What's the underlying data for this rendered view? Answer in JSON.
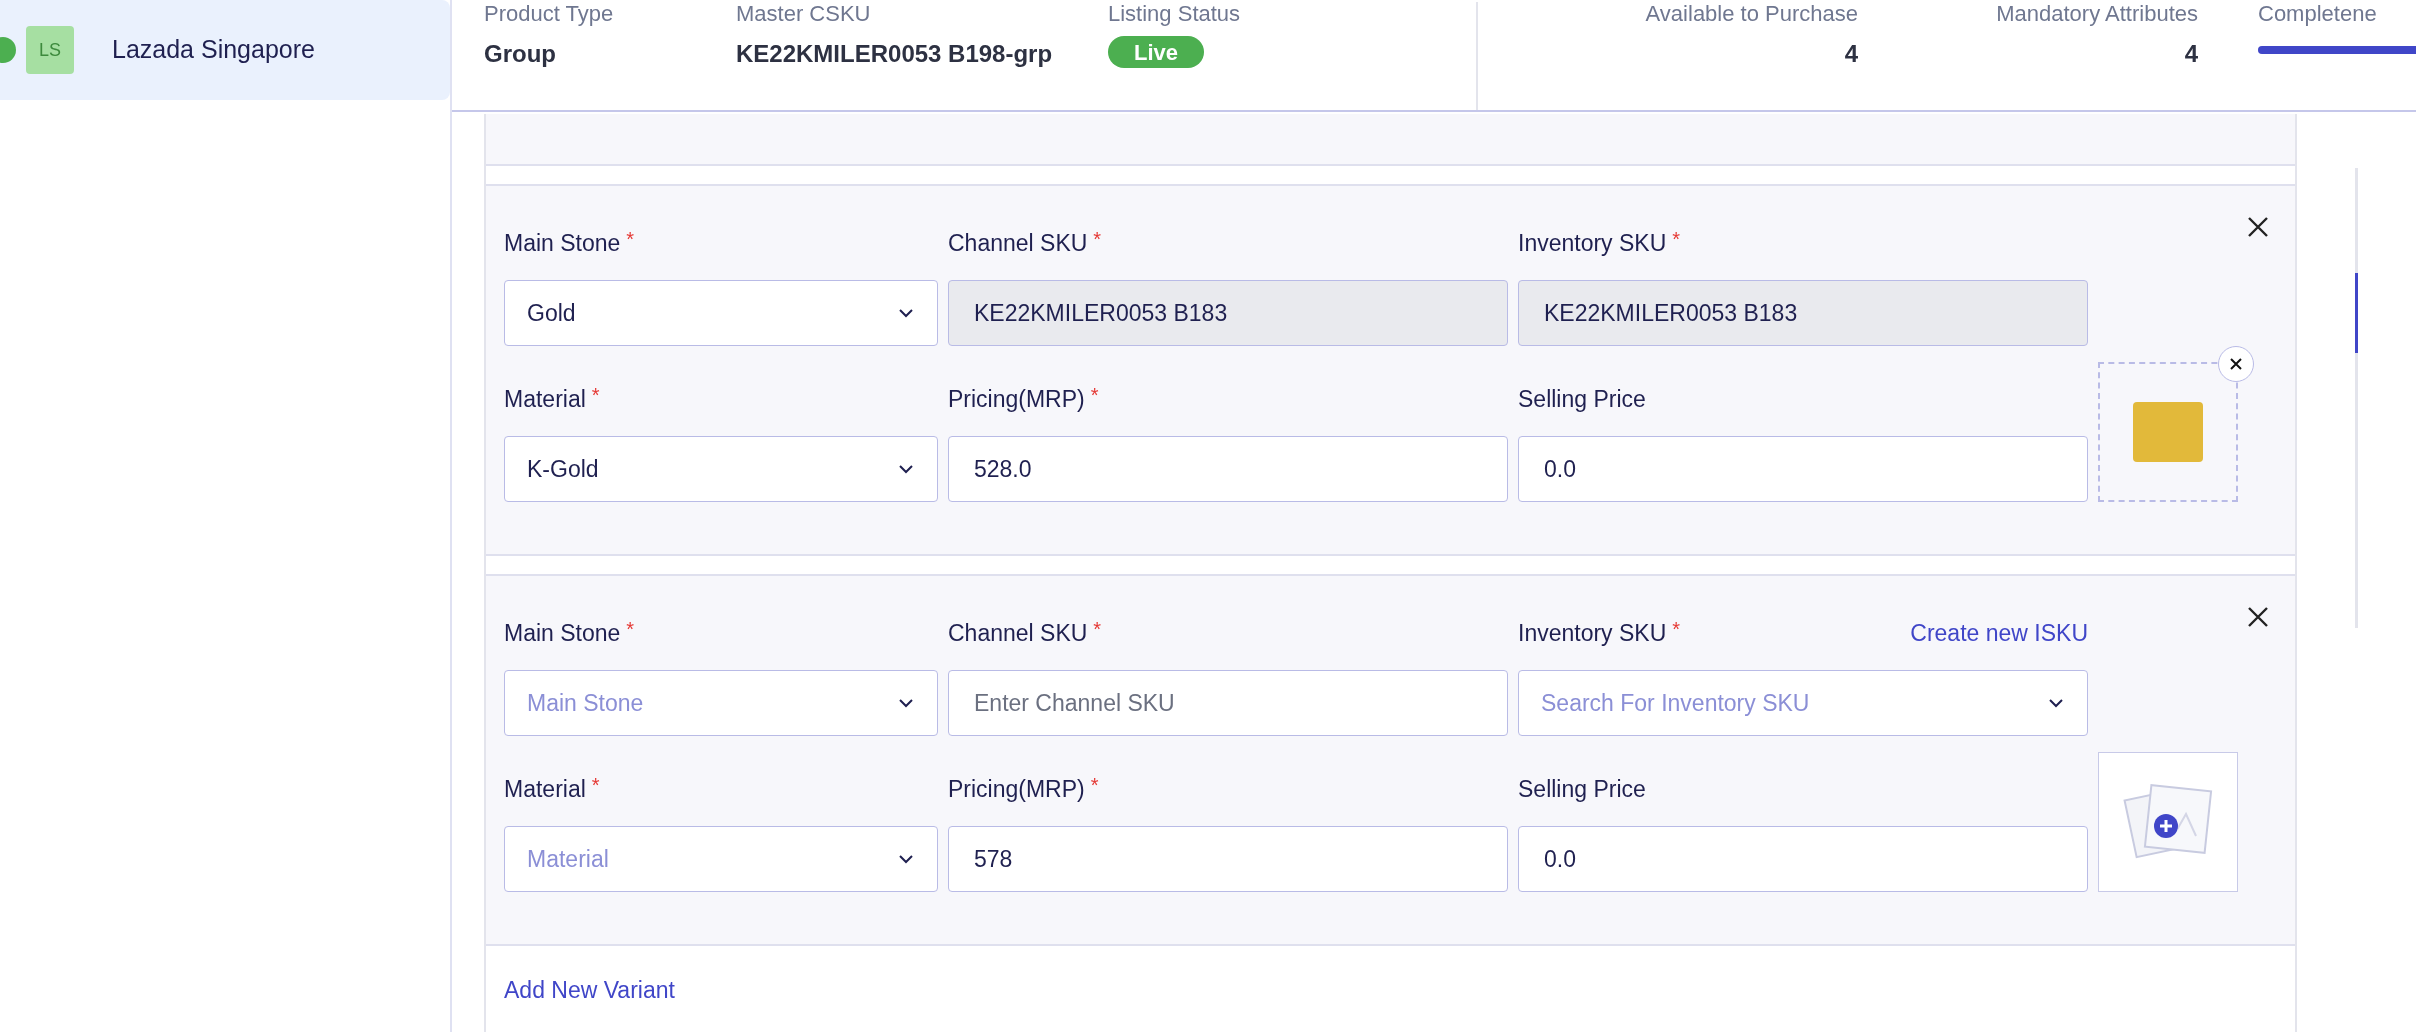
{
  "sidebar": {
    "items": [
      {
        "initials": "LS",
        "name": "Lazada Singapore",
        "selected": true,
        "online": true
      }
    ]
  },
  "header": {
    "fields": [
      {
        "label": "Product Type",
        "value": "Group"
      },
      {
        "label": "Master CSKU",
        "value": "KE22KMILER0053 B198-grp"
      },
      {
        "label": "Listing Status",
        "badge": "Live"
      }
    ],
    "stats": [
      {
        "label": "Available to Purchase",
        "value": "4"
      },
      {
        "label": "Mandatory Attributes",
        "value": "4"
      }
    ],
    "completeness": {
      "label": "Completene",
      "level": 1
    }
  },
  "variants": [
    {
      "fields": [
        {
          "kind": "select",
          "label": "Main Stone",
          "required_mark": "*",
          "value": "Gold"
        },
        {
          "kind": "input",
          "label": "Channel SKU",
          "required_mark": "*",
          "value": "KE22KMILER0053 B183",
          "disabled": true
        },
        {
          "kind": "input",
          "label": "Inventory SKU",
          "required_mark": "*",
          "value": "KE22KMILER0053 B183",
          "disabled": true
        },
        {
          "kind": "select",
          "label": "Material",
          "required_mark": "*",
          "value": "K-Gold"
        },
        {
          "kind": "input",
          "label": "Pricing(MRP)",
          "required_mark": "*",
          "value": "528.0"
        },
        {
          "kind": "input",
          "label": "Selling Price",
          "value": "0.0"
        }
      ],
      "image": {
        "kind": "photo"
      }
    },
    {
      "link": "Create new ISKU",
      "fields": [
        {
          "kind": "select",
          "label": "Main Stone",
          "required_mark": "*",
          "placeholder": "Main Stone"
        },
        {
          "kind": "input",
          "label": "Channel SKU",
          "required_mark": "*",
          "placeholder": "Enter Channel SKU"
        },
        {
          "kind": "select",
          "label": "Inventory SKU",
          "required_mark": "*",
          "placeholder": "Search For Inventory SKU"
        },
        {
          "kind": "select",
          "label": "Material",
          "required_mark": "*",
          "placeholder": "Material"
        },
        {
          "kind": "input",
          "label": "Pricing(MRP)",
          "required_mark": "*",
          "value": "578"
        },
        {
          "kind": "input",
          "label": "Selling Price",
          "value": "0.0"
        }
      ],
      "image": {
        "kind": "upload"
      }
    }
  ],
  "add_variant": "Add New Variant"
}
